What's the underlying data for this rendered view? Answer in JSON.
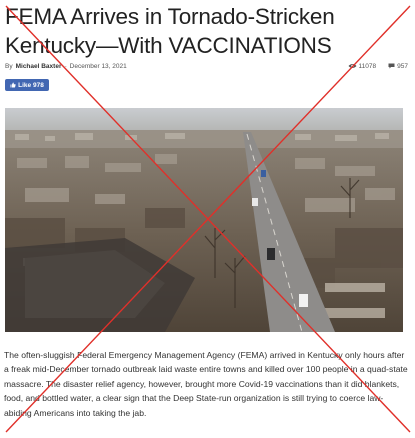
{
  "article": {
    "title": "FEMA Arrives in Tornado-Stricken Kentucky—With VACCINATIONS",
    "by_prefix": "By",
    "author": "Michael Baxter",
    "separator": "-",
    "date": "December 13, 2021",
    "views": "11078",
    "comments": "957",
    "like_label": "Like 978",
    "body": "The often-sluggish Federal Emergency Management Agency (FEMA) arrived in Kentucky only hours after a freak mid-December tornado outbreak laid waste entire towns and killed over 100 people in a quad-state massacre. The disaster relief agency, however, brought more Covid-19 vaccinations than it did blankets, food, and bottled water, a clear sign that the Deep State-run organization is still trying to coerce law-abiding Americans into taking the jab."
  },
  "icons": {
    "views": "eye-icon",
    "comments": "comment-icon",
    "like": "thumbs-up-icon"
  },
  "colors": {
    "facebook_blue": "#4267b2",
    "strike_red": "#e0302a",
    "title_text": "#222222"
  }
}
